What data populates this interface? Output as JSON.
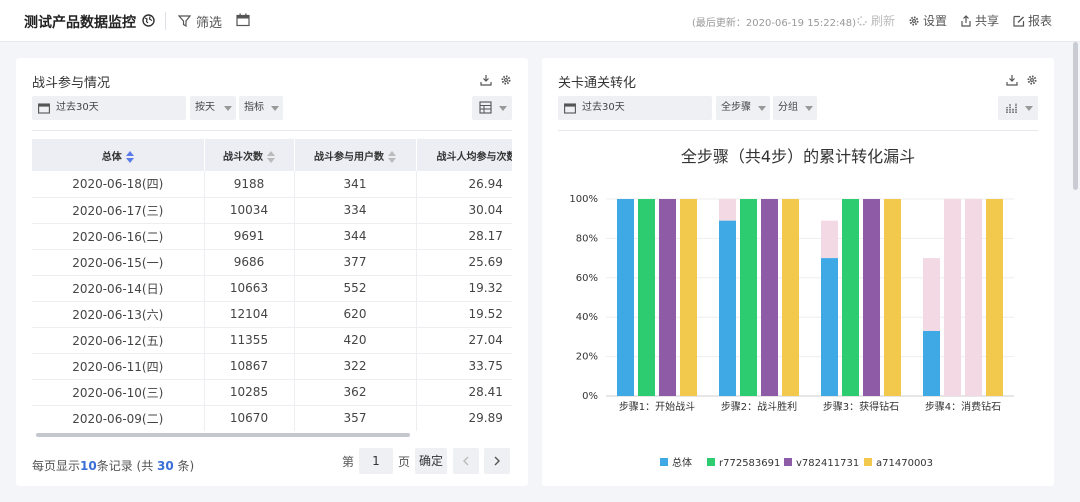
{
  "header": {
    "title": "测试产品数据监控",
    "filter_label": "筛选",
    "last_updated": "(最后更新：2020-06-19 15:22:48)",
    "actions": {
      "refresh": "刷新",
      "settings": "设置",
      "share": "共享",
      "report": "报表"
    }
  },
  "battle_panel": {
    "title": "战斗参与情况",
    "date_range": "过去30天",
    "granularity": "按天",
    "metric": "指标",
    "columns": [
      {
        "label": "总体"
      },
      {
        "label": "战斗次数"
      },
      {
        "label": "战斗参与用户数"
      },
      {
        "label": "战斗人均参与次数"
      }
    ],
    "rows": [
      [
        "2020-06-18(四)",
        "9188",
        "341",
        "26.94"
      ],
      [
        "2020-06-17(三)",
        "10034",
        "334",
        "30.04"
      ],
      [
        "2020-06-16(二)",
        "9691",
        "344",
        "28.17"
      ],
      [
        "2020-06-15(一)",
        "9686",
        "377",
        "25.69"
      ],
      [
        "2020-06-14(日)",
        "10663",
        "552",
        "19.32"
      ],
      [
        "2020-06-13(六)",
        "12104",
        "620",
        "19.52"
      ],
      [
        "2020-06-12(五)",
        "11355",
        "420",
        "27.04"
      ],
      [
        "2020-06-11(四)",
        "10867",
        "322",
        "33.75"
      ],
      [
        "2020-06-10(三)",
        "10285",
        "362",
        "28.41"
      ],
      [
        "2020-06-09(二)",
        "10670",
        "357",
        "29.89"
      ]
    ],
    "pagination": {
      "summary_prefix": "每页显示",
      "per_page": "10",
      "summary_mid": "条记录 (共 ",
      "total": "30",
      "summary_suffix": " 条)",
      "page_prefix": "第",
      "page_value": "1",
      "page_suffix": "页",
      "confirm": "确定"
    }
  },
  "funnel_panel": {
    "title": "关卡通关转化",
    "date_range": "过去30天",
    "step_select": "全步骤",
    "group_select": "分组"
  },
  "colors": {
    "series": [
      "#3fa9e6",
      "#2ecc71",
      "#8e5ba6",
      "#f2c94c"
    ],
    "remainder": "#f2d9e3",
    "accent": "#3a6fd8"
  },
  "chart_data": {
    "type": "bar",
    "title": "全步骤（共4步）的累计转化漏斗",
    "categories": [
      "步骤1：开始战斗",
      "步骤2：战斗胜利",
      "步骤3：获得钻石",
      "步骤4：消费钻石"
    ],
    "series": [
      {
        "name": "总体",
        "values": [
          100,
          89,
          70,
          33
        ],
        "previous": [
          100,
          100,
          89,
          70
        ]
      },
      {
        "name": "r772583691",
        "values": [
          100,
          100,
          100,
          0
        ],
        "previous": [
          100,
          100,
          100,
          100
        ]
      },
      {
        "name": "v782411731",
        "values": [
          100,
          100,
          100,
          0
        ],
        "previous": [
          100,
          100,
          100,
          100
        ]
      },
      {
        "name": "a71470003",
        "values": [
          100,
          100,
          100,
          100
        ],
        "previous": [
          100,
          100,
          100,
          100
        ]
      }
    ],
    "yticks": [
      "0%",
      "20%",
      "40%",
      "60%",
      "80%",
      "100%"
    ],
    "ylim": [
      0,
      100
    ],
    "legend_position": "bottom"
  }
}
